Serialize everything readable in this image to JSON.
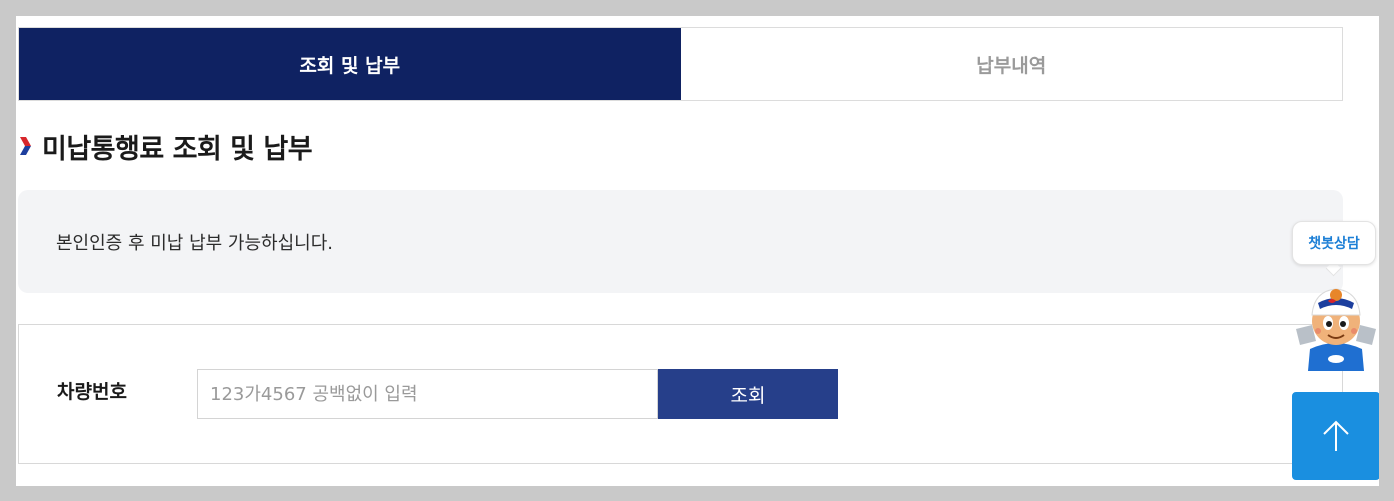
{
  "tabs": [
    {
      "label": "조회 및 납부",
      "active": true
    },
    {
      "label": "납부내역",
      "active": false
    }
  ],
  "section": {
    "title": "미납통행료 조회 및 납부"
  },
  "info": {
    "text": "본인인증 후 미납 납부 가능하십니다."
  },
  "form": {
    "plate_label": "차량번호",
    "plate_value": "",
    "plate_placeholder": "123가4567 공백없이 입력",
    "search_label": "조회"
  },
  "chatbot": {
    "label": "챗봇상담",
    "icon": "chatbot-mascot-icon"
  },
  "scroll_top": {
    "icon": "arrow-up-icon"
  },
  "colors": {
    "active_tab": "#0f2262",
    "button": "#263f8a",
    "scroll_top": "#1a8fe0",
    "chevron_red": "#d7262b",
    "chevron_blue": "#1d3f9e"
  }
}
